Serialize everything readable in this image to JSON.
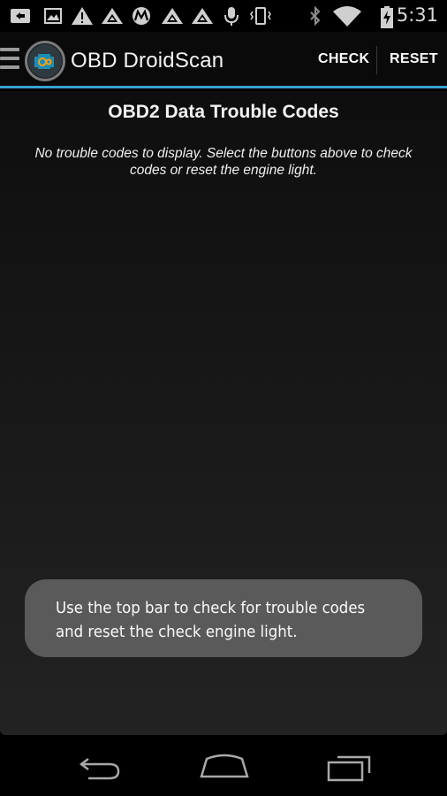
{
  "status_bar": {
    "time": "5:31",
    "left_icons": [
      "keyboard-icon",
      "image-icon",
      "warning-icon",
      "mountain-icon",
      "motorola-icon",
      "mountain-icon",
      "mountain-icon",
      "microphone-icon",
      "vibrate-icon"
    ],
    "right_icons": [
      "bluetooth-icon",
      "wifi-icon",
      "battery-icon"
    ]
  },
  "action_bar": {
    "title": "OBD DroidScan",
    "check_label": "CHECK",
    "reset_label": "RESET",
    "accent_color": "#34a5d3"
  },
  "content": {
    "title": "OBD2 Data Trouble Codes",
    "message": "No trouble codes to display.  Select the buttons above to check codes or reset the engine light."
  },
  "toast": {
    "text": "Use the top bar to check for trouble codes and reset the check engine light."
  },
  "nav_bar": {
    "icons": [
      "back-icon",
      "home-icon",
      "recent-apps-icon"
    ]
  }
}
